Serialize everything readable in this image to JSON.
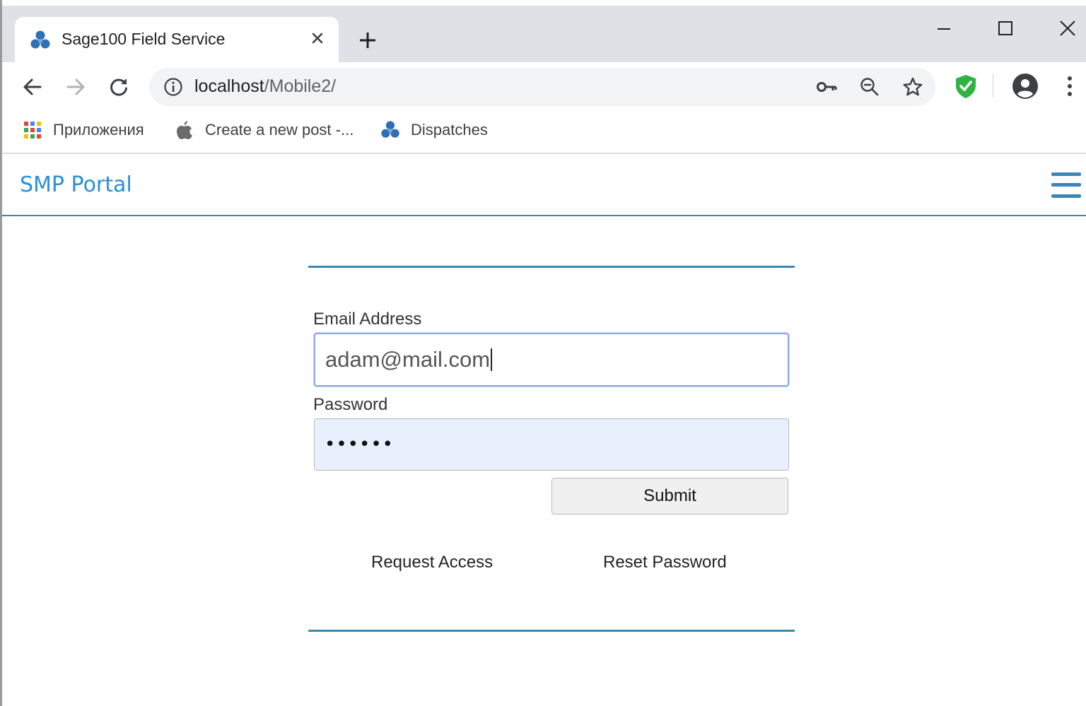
{
  "browser": {
    "tab": {
      "title": "Sage100 Field Service",
      "close": "×"
    },
    "new_tab": "+",
    "window_controls": {
      "minimize": "minimize-icon",
      "maximize": "maximize-icon",
      "close": "close-icon"
    },
    "address": {
      "host": "localhost",
      "path": "/Mobile2/"
    },
    "bookmarks": [
      {
        "label": "Приложения",
        "icon": "apps-grid-icon"
      },
      {
        "label": "Create a new post -...",
        "icon": "apple-icon"
      },
      {
        "label": "Dispatches",
        "icon": "sage-logo-icon"
      }
    ],
    "colors": {
      "tabstrip": "#dee1e6",
      "omnibox": "#f1f3f4",
      "shield": "#2fb344"
    }
  },
  "page": {
    "brand": "SMP Portal",
    "form": {
      "email_label": "Email Address",
      "email_value": "adam@mail.com",
      "password_label": "Password",
      "password_value": "••••••",
      "submit_label": "Submit",
      "request_access": "Request Access",
      "reset_password": "Reset Password"
    },
    "colors": {
      "accent": "#3a87b7",
      "brand": "#2b8fd6",
      "autofill": "#e8f0fe"
    }
  }
}
